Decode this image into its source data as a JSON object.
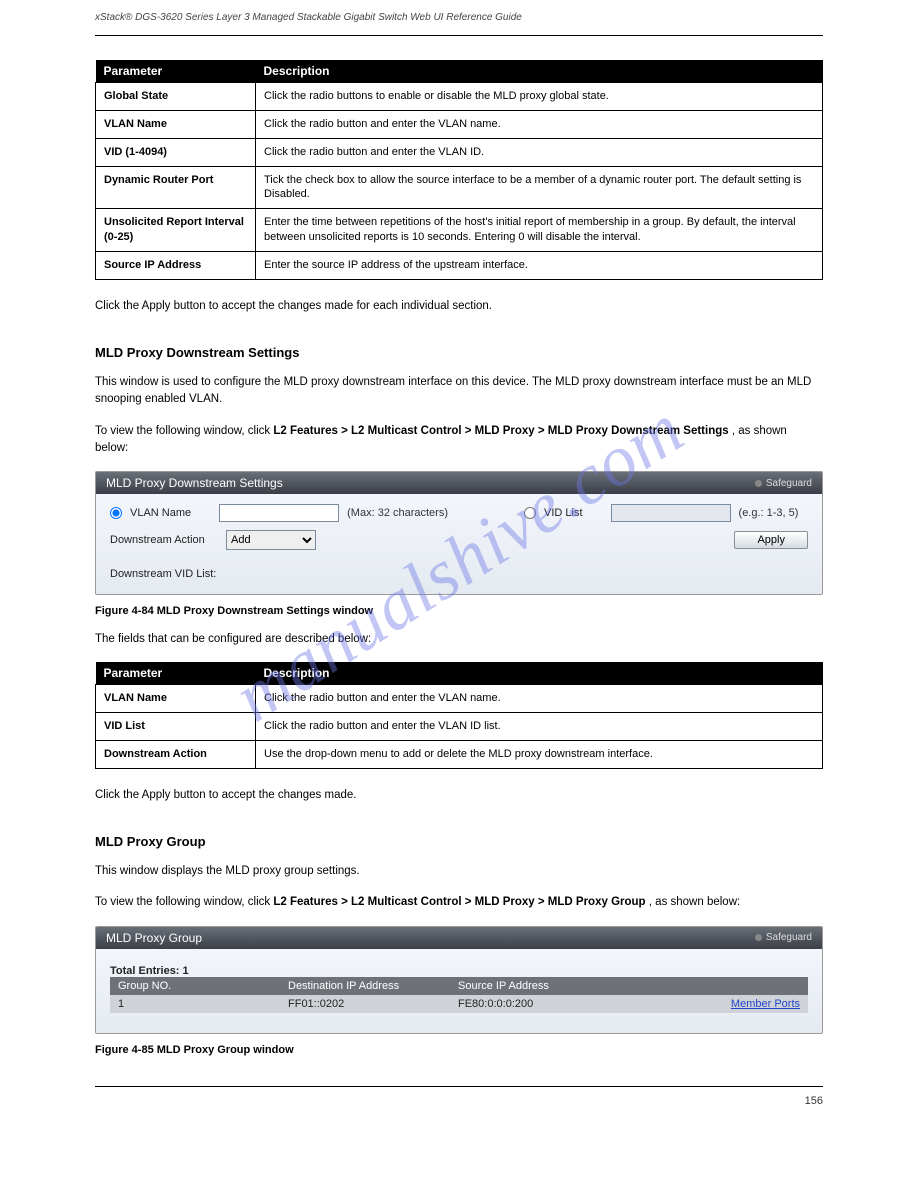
{
  "header": {
    "doc_title": "xStack® DGS-3620 Series Layer 3 Managed Stackable Gigabit Switch Web UI Reference Guide"
  },
  "table1": {
    "h1": "Parameter",
    "h2": "Description",
    "rows": [
      {
        "p": "Global State",
        "d": "Click the radio buttons to enable or disable the MLD proxy global state."
      },
      {
        "p": "VLAN Name",
        "d": "Click the radio button and enter the VLAN name."
      },
      {
        "p": "VID (1-4094)",
        "d": "Click the radio button and enter the VLAN ID."
      },
      {
        "p": "Dynamic Router Port",
        "d": "Tick the check box to allow the source interface to be a member of a dynamic router port. The default setting is Disabled."
      },
      {
        "p": "Unsolicited Report Interval (0-25)",
        "d": "Enter the time between repetitions of the host's initial report of membership in a group. By default, the interval between unsolicited reports is 10 seconds. Entering 0 will disable the interval."
      },
      {
        "p": "Source IP Address",
        "d": "Enter the source IP address of the upstream interface."
      }
    ]
  },
  "after_t1": "Click the Apply button to accept the changes made for each individual section.",
  "sec2": {
    "title": "MLD Proxy Downstream Settings",
    "desc_pre": "This window is used to configure the MLD proxy downstream interface on this device. The MLD proxy downstream interface must be an MLD snooping enabled VLAN.",
    "view_path_pre": "To view the following window, click ",
    "view_path_bold": "L2 Features > L2 Multicast Control > MLD Proxy > MLD Proxy Downstream Settings",
    "view_path_post": ", as shown below:"
  },
  "panel1": {
    "title": "MLD Proxy Downstream Settings",
    "safeguard": "Safeguard",
    "vlan_label": "VLAN Name",
    "vlan_hint": "(Max: 32 characters)",
    "vid_label": "VID List",
    "vid_hint": "(e.g.: 1-3, 5)",
    "action_label": "Downstream Action",
    "action_value": "Add",
    "apply": "Apply",
    "list_label": "Downstream VID List:"
  },
  "fig1": "Figure 4-84 MLD Proxy Downstream Settings window",
  "t2_intro": "The fields that can be configured are described below:",
  "table2": {
    "h1": "Parameter",
    "h2": "Description",
    "rows": [
      {
        "p": "VLAN Name",
        "d": "Click the radio button and enter the VLAN name."
      },
      {
        "p": "VID List",
        "d": "Click the radio button and enter the VLAN ID list."
      },
      {
        "p": "Downstream Action",
        "d": "Use the drop-down menu to add or delete the MLD proxy downstream interface."
      }
    ]
  },
  "after_t2": "Click the Apply button to accept the changes made.",
  "sec3": {
    "title": "MLD Proxy Group",
    "desc": "This window displays the MLD proxy group settings.",
    "view_path_pre": "To view the following window, click ",
    "view_path_bold": "L2 Features > L2 Multicast Control > MLD Proxy > MLD Proxy Group",
    "view_path_post": ", as shown below:"
  },
  "panel2": {
    "title": "MLD Proxy Group",
    "safeguard": "Safeguard",
    "total": "Total Entries: 1",
    "cols": [
      "Group NO.",
      "Destination IP Address",
      "Source IP Address",
      ""
    ],
    "row": [
      "1",
      "FF01::0202",
      "FE80:0:0:0:200",
      ""
    ],
    "link": "Member Ports"
  },
  "fig2": "Figure 4-85 MLD Proxy Group window",
  "footer": {
    "page": "156"
  },
  "watermark": "manualshive.com"
}
